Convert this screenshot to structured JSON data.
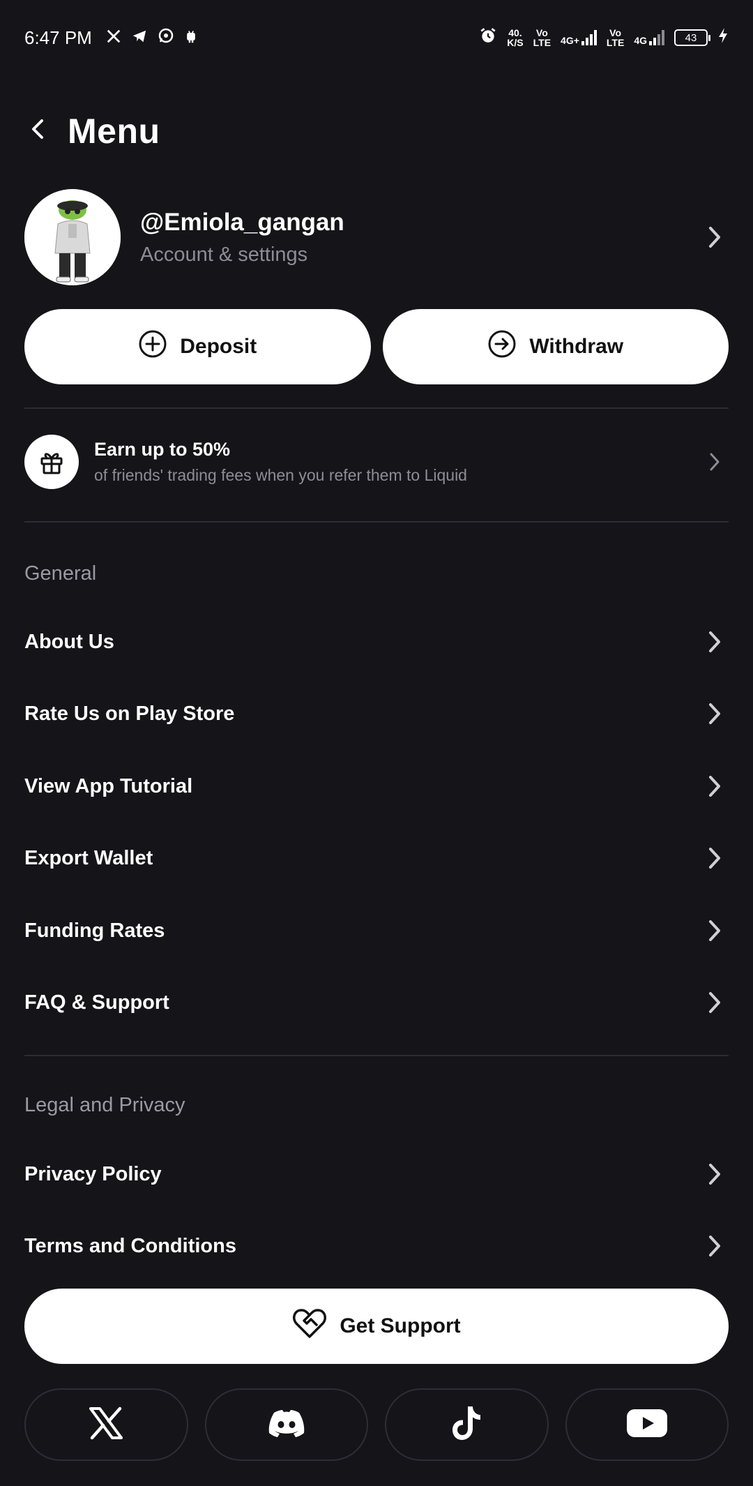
{
  "status_bar": {
    "time": "6:47 PM",
    "speed_value": "40.",
    "speed_unit": "K/S",
    "vo1": "Vo",
    "lte1": "LTE",
    "net1": "4G+",
    "vo2": "Vo",
    "lte2": "LTE",
    "net2": "4G",
    "battery": "43"
  },
  "header": {
    "title": "Menu"
  },
  "profile": {
    "username": "@Emiola_gangan",
    "subtitle": "Account & settings"
  },
  "actions": {
    "deposit_label": "Deposit",
    "withdraw_label": "Withdraw"
  },
  "referral": {
    "title": "Earn up to 50%",
    "subtitle": "of friends' trading fees when you refer them to Liquid"
  },
  "general": {
    "title": "General",
    "items": [
      {
        "label": "About Us"
      },
      {
        "label": "Rate Us on Play Store"
      },
      {
        "label": "View App Tutorial"
      },
      {
        "label": "Export Wallet"
      },
      {
        "label": "Funding Rates"
      },
      {
        "label": "FAQ & Support"
      }
    ]
  },
  "legal": {
    "title": "Legal and Privacy",
    "items": [
      {
        "label": "Privacy Policy"
      },
      {
        "label": "Terms and Conditions"
      }
    ]
  },
  "support": {
    "label": "Get Support"
  },
  "socials": [
    "x-icon",
    "discord-icon",
    "tiktok-icon",
    "youtube-icon"
  ],
  "colors": {
    "background": "#141419",
    "button": "#ffffff",
    "muted_text": "#8d8d93",
    "divider": "#2c2c33"
  }
}
